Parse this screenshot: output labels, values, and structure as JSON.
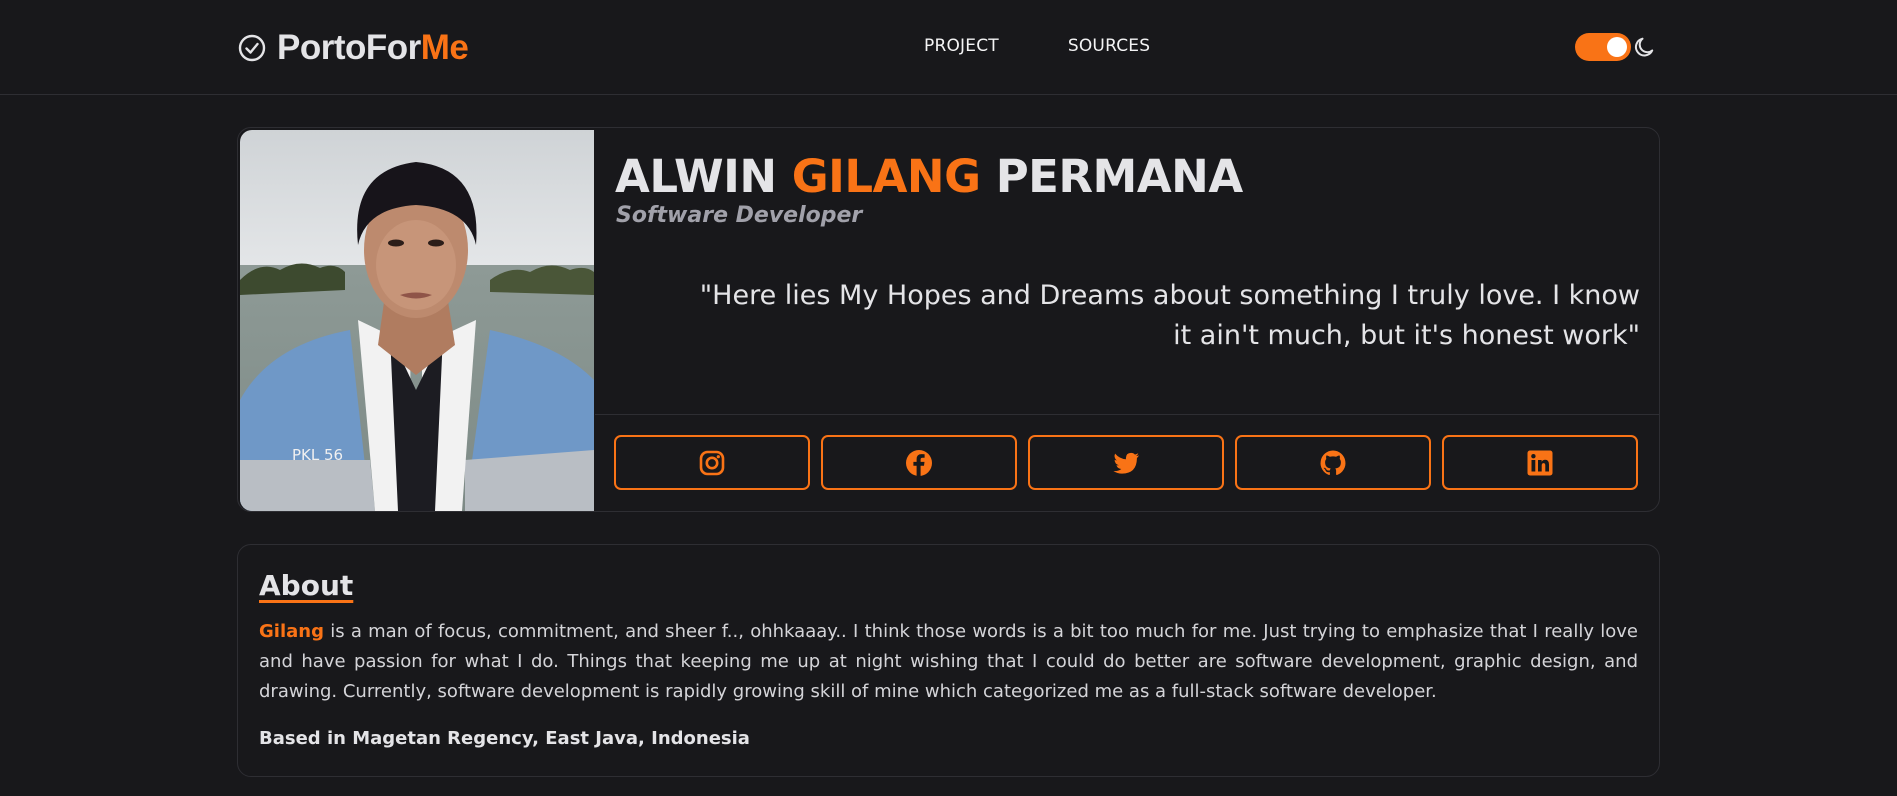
{
  "nav": {
    "brand_main": "PortoFor",
    "brand_accent": "Me",
    "links": [
      "PROJECT",
      "SOURCES"
    ],
    "theme_toggle_on": true
  },
  "profile": {
    "first_name": "ALWIN",
    "middle_name": "GILANG",
    "last_name": "PERMANA",
    "role": "Software Developer",
    "quote": "\"Here lies My Hopes and Dreams about something I truly love. I know it ain't much, but it's honest work\"",
    "photo_badge_text": "PKL 56",
    "socials": [
      "instagram-icon",
      "facebook-icon",
      "twitter-icon",
      "github-icon",
      "linkedin-icon"
    ]
  },
  "about": {
    "title": "About",
    "highlight": "Gilang",
    "body": " is a man of focus, commitment, and sheer f.., ohhkaaay.. I think those words is a bit too much for me. Just trying to emphasize that I really love and have passion for what I do. Things that keeping me up at night wishing that I could do better are software development, graphic design, and drawing. Currently, software development is rapidly growing skill of mine which categorized me as a full-stack software developer.",
    "location": "Based in Magetan Regency, East Java, Indonesia"
  },
  "colors": {
    "accent": "#f97316",
    "background": "#18181b",
    "border": "#2e2e33",
    "text": "#e4e4e7"
  }
}
